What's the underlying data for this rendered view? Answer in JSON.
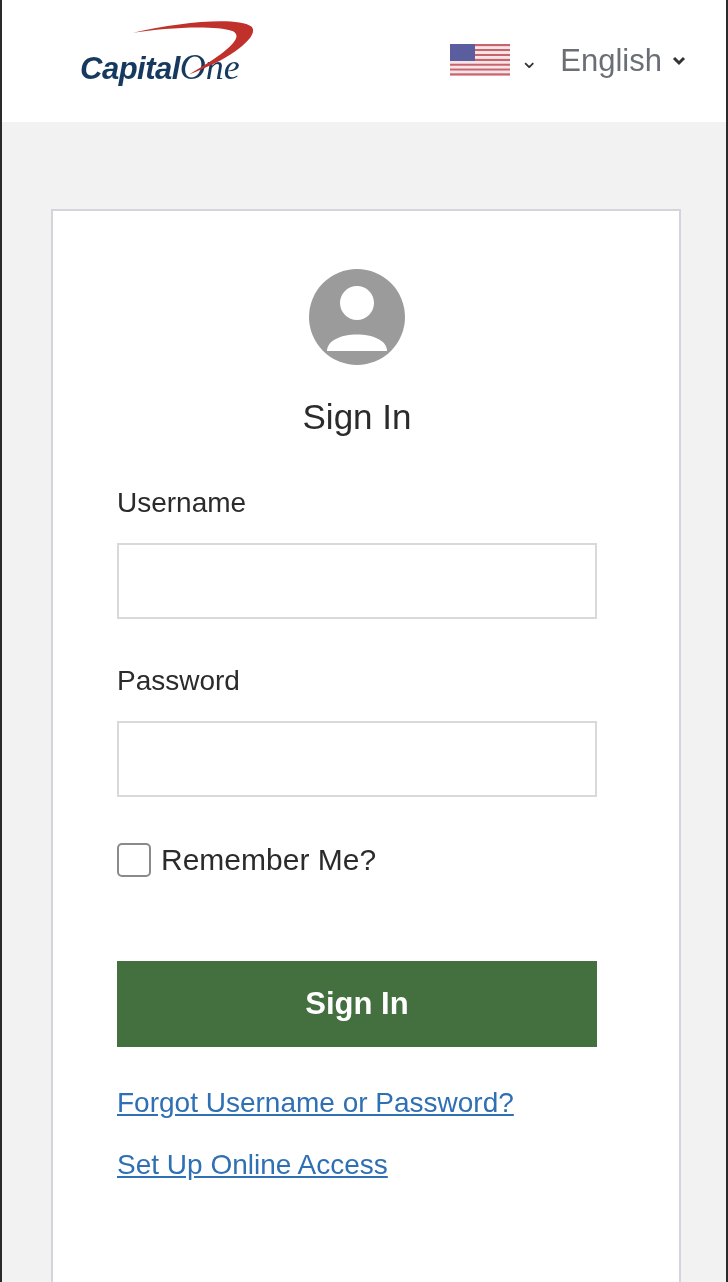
{
  "header": {
    "logo": {
      "word_1": "Capital",
      "word_2": "One"
    },
    "country_selector": {
      "caret": "⌄"
    },
    "language_selector": {
      "label": "English"
    }
  },
  "sign_in": {
    "title": "Sign In",
    "fields": [
      {
        "label": "Username"
      },
      {
        "label": "Password"
      }
    ],
    "remember_me": {
      "label": "Remember Me?",
      "checked": false
    },
    "submit": "Sign In",
    "links": [
      "Forgot Username or Password?",
      "Set Up Online Access"
    ]
  }
}
